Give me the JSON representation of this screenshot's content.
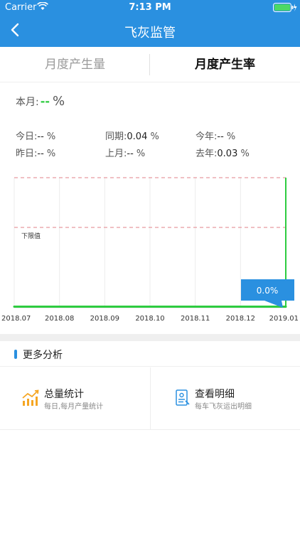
{
  "status": {
    "carrier": "Carrier",
    "time": "7:13 PM"
  },
  "nav": {
    "title": "飞灰监管"
  },
  "tabs": [
    {
      "label": "月度产生量"
    },
    {
      "label": "月度产生率"
    }
  ],
  "current": {
    "label": "本月:",
    "value": "--",
    "unit": "%"
  },
  "stats": {
    "today": {
      "label": "今日:",
      "value": "--",
      "unit": "%"
    },
    "same_period": {
      "label": "同期:",
      "value": "0.04",
      "unit": "%"
    },
    "this_year": {
      "label": "今年:",
      "value": "--",
      "unit": "%"
    },
    "yesterday": {
      "label": "昨日:",
      "value": "--",
      "unit": "%"
    },
    "last_month": {
      "label": "上月:",
      "value": "--",
      "unit": "%"
    },
    "last_year": {
      "label": "去年:",
      "value": "0.03",
      "unit": "%"
    }
  },
  "chart_data": {
    "type": "line",
    "categories": [
      "2018.07",
      "2018.08",
      "2018.09",
      "2018.10",
      "2018.11",
      "2018.12",
      "2019.01"
    ],
    "series": [
      {
        "values": [
          0.0,
          0.0,
          0.0,
          0.0,
          0.0,
          0.0,
          0.0
        ]
      }
    ],
    "annotation": "下限值",
    "tooltip": "0.0%",
    "colors": {
      "line": "#2ecc40",
      "threshold": "#e89aa0",
      "tooltip": "#2a90e0"
    }
  },
  "more": {
    "title": "更多分析",
    "cards": [
      {
        "title": "总量统计",
        "subtitle": "每日,每月产量统计",
        "icon": "trend-chart-icon"
      },
      {
        "title": "查看明细",
        "subtitle": "每车飞灰运出明细",
        "icon": "document-icon"
      }
    ]
  }
}
